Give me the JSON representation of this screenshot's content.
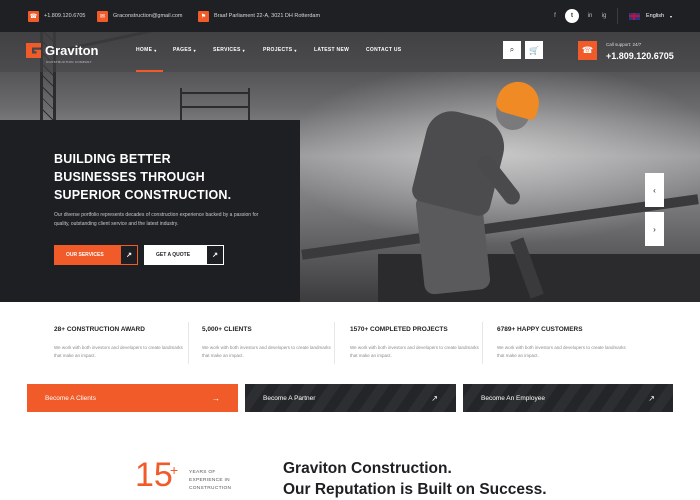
{
  "topbar": {
    "phone": "+1.809.120.6705",
    "email": "Graconstruction@gmail.com",
    "address": "Braaf Parliament 22-A, 3021 DH Rotterdam",
    "social": [
      "f",
      "t",
      "in",
      "ig"
    ],
    "language": "English"
  },
  "header": {
    "brand": "Graviton",
    "brand_sub": "CONSTRUCTION COMPANY",
    "nav": [
      {
        "label": "HOME",
        "dropdown": true
      },
      {
        "label": "PAGES",
        "dropdown": true
      },
      {
        "label": "SERVICES",
        "dropdown": true
      },
      {
        "label": "PROJECTS",
        "dropdown": true
      },
      {
        "label": "LATEST NEW",
        "dropdown": false
      },
      {
        "label": "CONTACT US",
        "dropdown": false
      }
    ],
    "call_label": "Call support: 24/7",
    "call_number": "+1.809.120.6705"
  },
  "hero": {
    "title_line1": "BUILDING BETTER",
    "title_line2": "BUSINESSES THROUGH",
    "title_line3": "SUPERIOR CONSTRUCTION.",
    "description": "Our diverse portfolio represents decades of construction experience backed by a passion for quality, outstanding client service and the latest industry.",
    "primary_button": "OUR SERVICES",
    "secondary_button": "GET A QUOTE"
  },
  "stats": [
    {
      "title": "28+ CONSTRUCTION AWARD",
      "desc": "We work with both investors and developers to create landmarks that make an impact."
    },
    {
      "title": "5,000+ CLIENTS",
      "desc": "We work with both investors and developers to create landmarks that make an impact."
    },
    {
      "title": "1570+ COMPLETED PROJECTS",
      "desc": "We work with both investors and developers to create landmarks that make an impact."
    },
    {
      "title": "6789+ HAPPY CUSTOMERS",
      "desc": "We work with both investors and developers to create landmarks that make an impact."
    }
  ],
  "cta": [
    {
      "label": "Become A Clients"
    },
    {
      "label": "Become A Partner"
    },
    {
      "label": "Become An Employee"
    }
  ],
  "about": {
    "years_number": "15",
    "years_plus": "+",
    "years_line1": "YEARS OF",
    "years_line2": "EXPERIENCE IN",
    "years_line3": "CONSTRUCTION",
    "heading_line1": "Graviton Construction.",
    "heading_line2": "Our Reputation is Built on Success."
  },
  "colors": {
    "accent": "#f15a29",
    "dark": "#1e1f22"
  }
}
